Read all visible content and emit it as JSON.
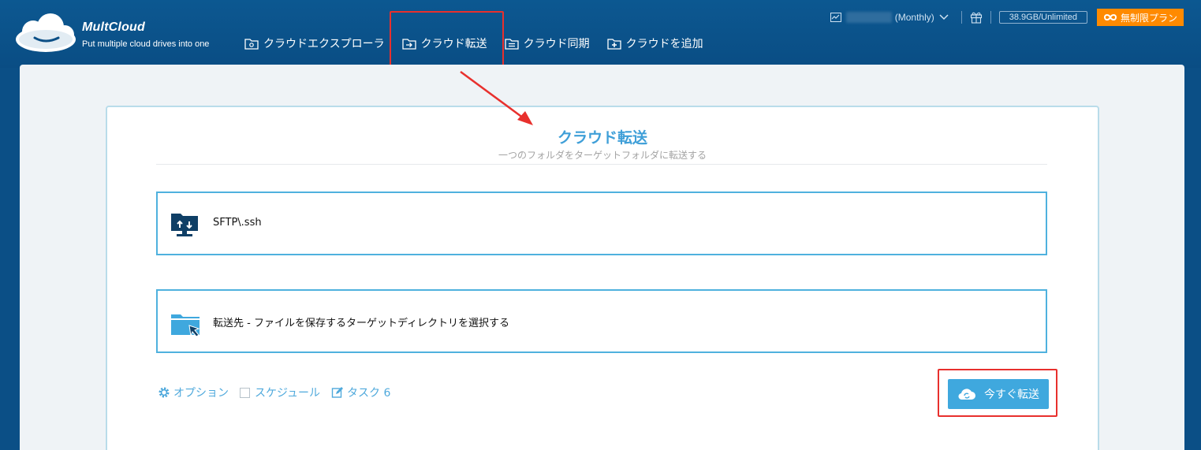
{
  "app": {
    "name": "MultCloud",
    "tagline": "Put multiple cloud drives into one"
  },
  "nav": {
    "items": [
      {
        "label": "クラウドエクスプローラ",
        "icon": "explorer-icon"
      },
      {
        "label": "クラウド転送",
        "icon": "transfer-icon",
        "active": true
      },
      {
        "label": "クラウド同期",
        "icon": "sync-icon"
      },
      {
        "label": "クラウドを追加",
        "icon": "add-cloud-icon"
      }
    ]
  },
  "account": {
    "plan": "(Monthly)",
    "storage": "38.9GB/Unlimited",
    "unlimited_button": "無制限プラン"
  },
  "page": {
    "title": "クラウド転送",
    "subtitle": "一つのフォルダをターゲットフォルダに転送する"
  },
  "source": {
    "label": "SFTP\\.ssh",
    "icon": "sftp-folder-icon"
  },
  "destination": {
    "label": "転送先 - ファイルを保存するターゲットディレクトリを選択する",
    "icon": "folder-select-icon"
  },
  "footer": {
    "options_label": "オプション",
    "schedule_label": "スケジュール",
    "task_label": "タスク 6",
    "transfer_now": "今すぐ転送"
  },
  "colors": {
    "header_bg": "#0b4f86",
    "accent": "#3fa8de",
    "highlight": "#e8302d",
    "orange": "#ff8a00"
  }
}
